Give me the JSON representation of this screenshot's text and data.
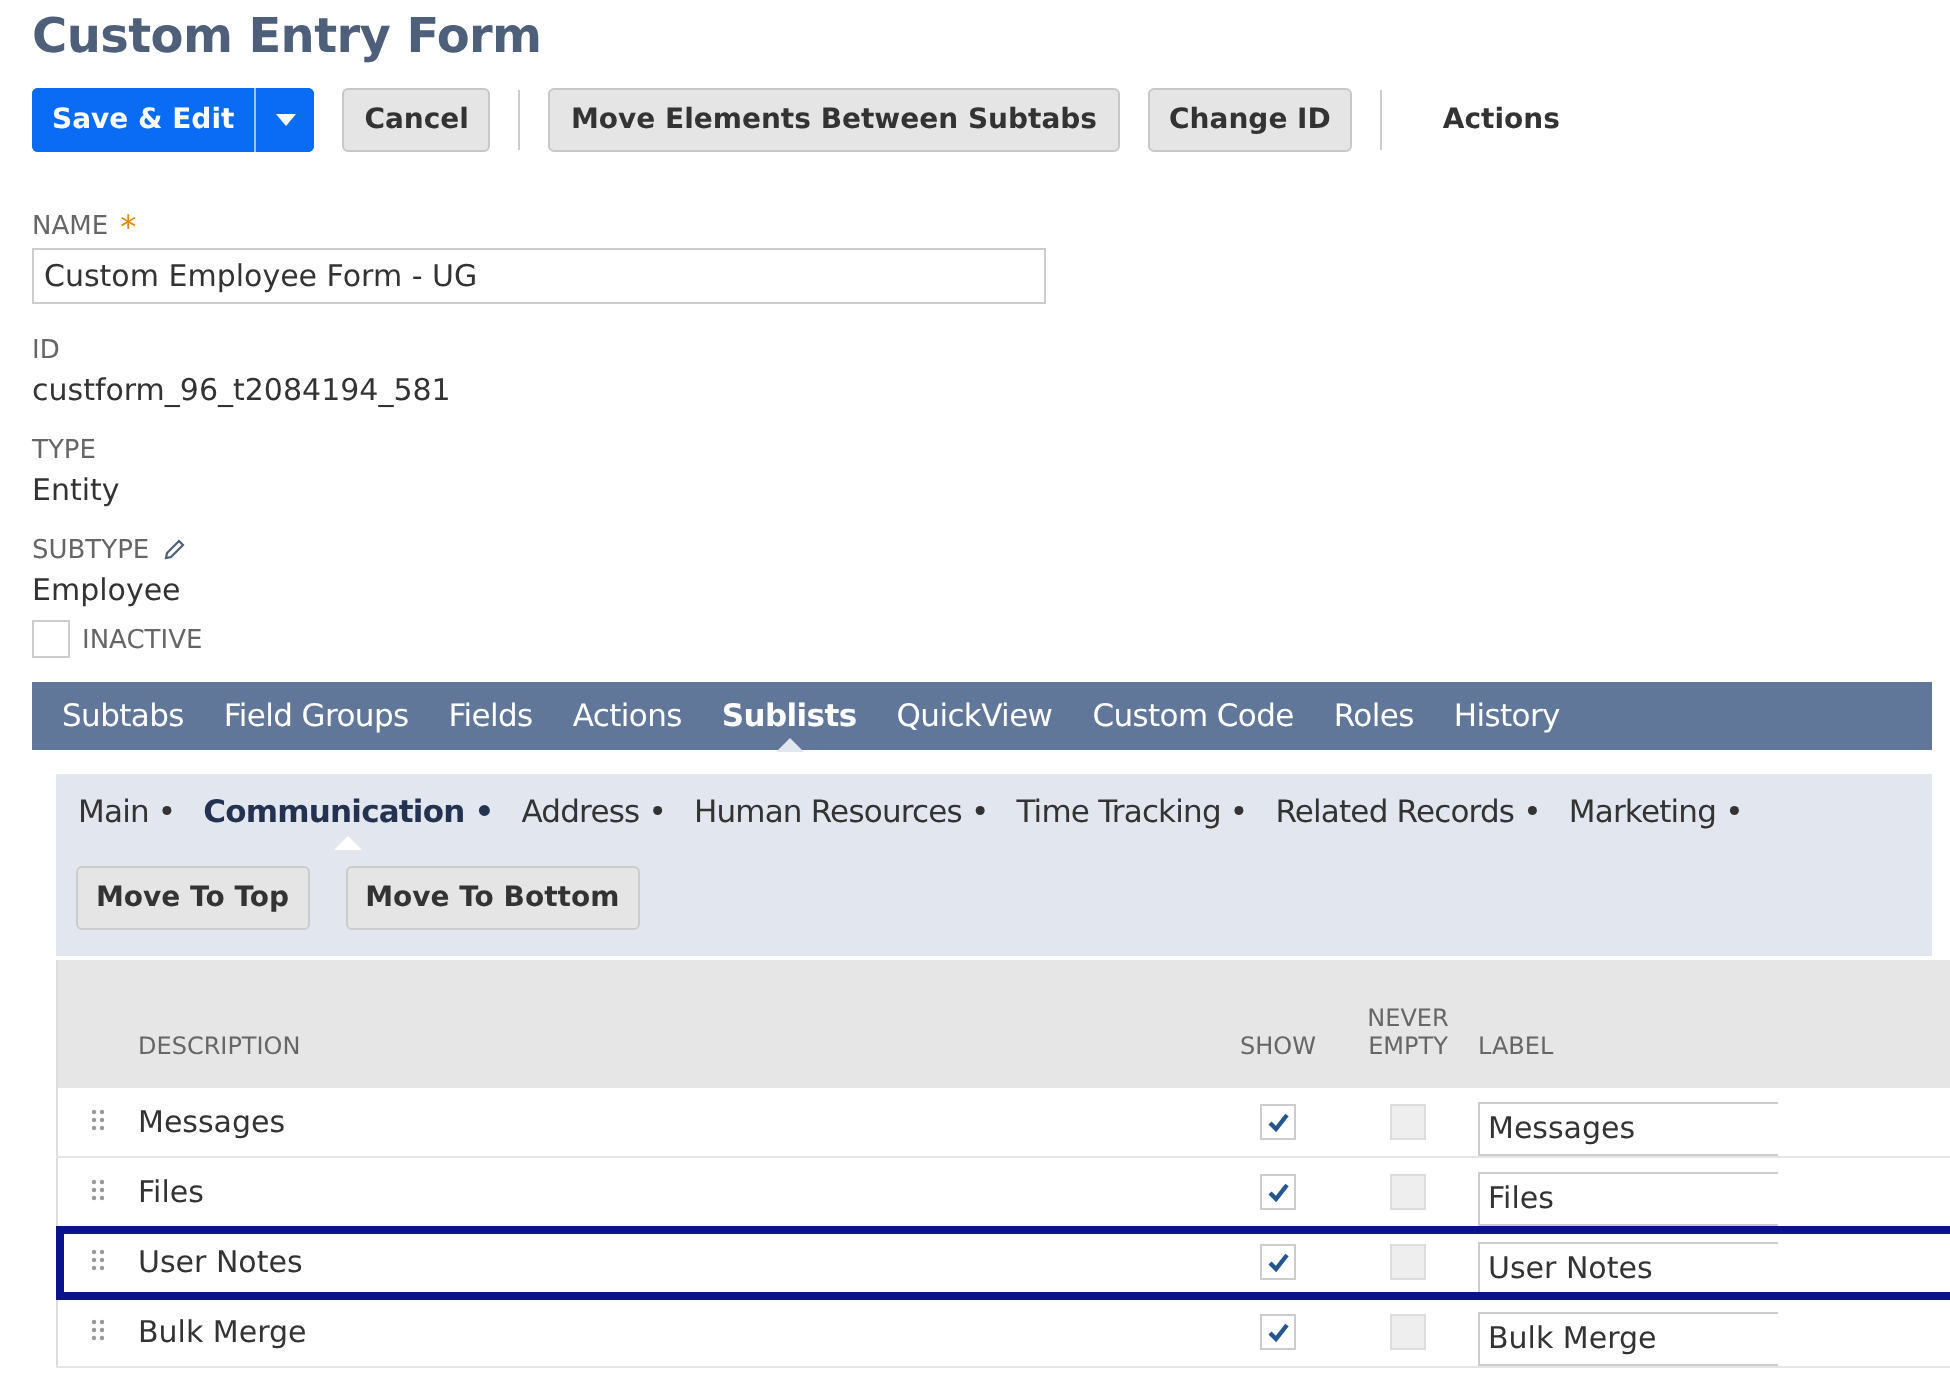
{
  "page_title": "Custom Entry Form",
  "toolbar": {
    "buttons": [
      {
        "label": "Save & Edit",
        "kind": "primary"
      },
      {
        "label": "Cancel",
        "kind": "secondary"
      },
      {
        "label": "Move Elements Between Subtabs",
        "kind": "secondary"
      },
      {
        "label": "Change ID",
        "kind": "secondary"
      },
      {
        "label": "Actions",
        "kind": "link"
      }
    ]
  },
  "fields": [
    {
      "label": "NAME",
      "kind": "input",
      "required_mark": "*",
      "value": "Custom Employee Form - UG"
    },
    {
      "label": "ID",
      "kind": "text",
      "value": "custform_96_t2084194_581"
    },
    {
      "label": "TYPE",
      "kind": "text",
      "value": "Entity"
    },
    {
      "label": "SUBTYPE",
      "kind": "editable",
      "value": "Employee"
    },
    {
      "label": "INACTIVE",
      "kind": "checkbox",
      "checked": false
    }
  ],
  "tabs": [
    {
      "label": "Subtabs",
      "selected": false
    },
    {
      "label": "Field Groups",
      "selected": false
    },
    {
      "label": "Fields",
      "selected": false
    },
    {
      "label": "Actions",
      "selected": false
    },
    {
      "label": "Sublists",
      "selected": true
    },
    {
      "label": "QuickView",
      "selected": false
    },
    {
      "label": "Custom Code",
      "selected": false
    },
    {
      "label": "Roles",
      "selected": false
    },
    {
      "label": "History",
      "selected": false
    }
  ],
  "subtabs": [
    {
      "label": "Main •",
      "selected": false
    },
    {
      "label": "Communication •",
      "selected": true
    },
    {
      "label": "Address •",
      "selected": false
    },
    {
      "label": "Human Resources •",
      "selected": false
    },
    {
      "label": "Time Tracking •",
      "selected": false
    },
    {
      "label": "Related Records •",
      "selected": false
    },
    {
      "label": "Marketing •",
      "selected": false
    }
  ],
  "sublist_buttons": [
    "Move To Top",
    "Move To Bottom"
  ],
  "table": {
    "columns": [
      "DESCRIPTION",
      "SHOW",
      "NEVER EMPTY",
      "LABEL"
    ],
    "rows": [
      {
        "description": "Messages",
        "show": true,
        "never_empty": false,
        "never_empty_disabled": true,
        "label": "Messages",
        "highlighted": false
      },
      {
        "description": "Files",
        "show": true,
        "never_empty": false,
        "never_empty_disabled": true,
        "label": "Files",
        "highlighted": false
      },
      {
        "description": "User Notes",
        "show": true,
        "never_empty": false,
        "never_empty_disabled": true,
        "label": "User Notes",
        "highlighted": true
      },
      {
        "description": "Bulk Merge",
        "show": true,
        "never_empty": false,
        "never_empty_disabled": true,
        "label": "Bulk Merge",
        "highlighted": false
      }
    ]
  }
}
